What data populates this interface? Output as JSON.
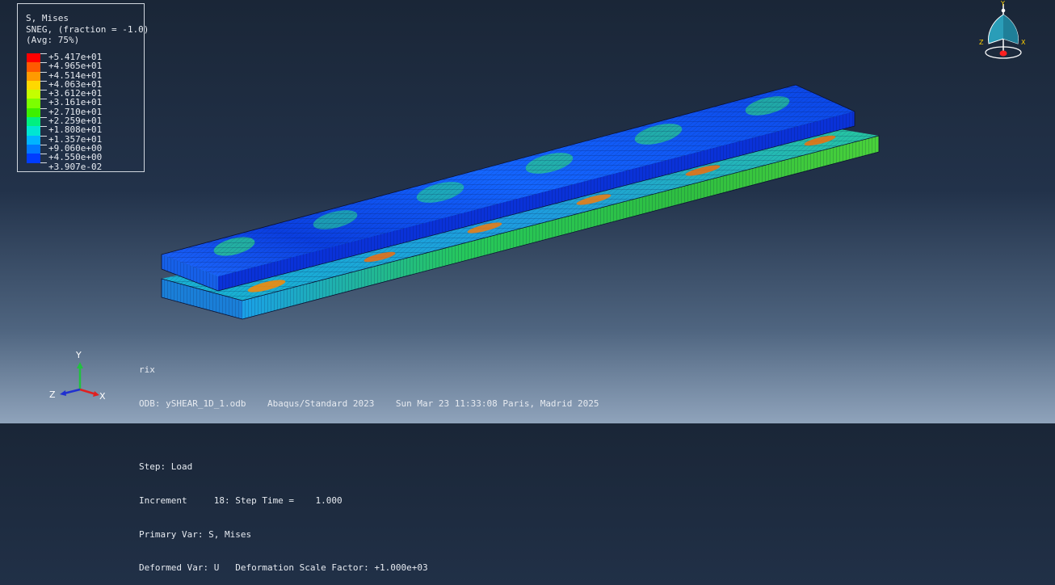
{
  "legend": {
    "title": "S, Mises",
    "subtitle": "SNEG, (fraction = -1.0)",
    "avg": "(Avg: 75%)",
    "colors": [
      "#ff0000",
      "#ff5a00",
      "#ff9a00",
      "#ffd800",
      "#c4ff00",
      "#7cff00",
      "#3cf000",
      "#00f080",
      "#00e6d2",
      "#00b4ff",
      "#0078ff",
      "#003cff"
    ],
    "values": [
      "+5.417e+01",
      "+4.965e+01",
      "+4.514e+01",
      "+4.063e+01",
      "+3.612e+01",
      "+3.161e+01",
      "+2.710e+01",
      "+2.259e+01",
      "+1.808e+01",
      "+1.357e+01",
      "+9.060e+00",
      "+4.550e+00",
      "+3.907e-02"
    ]
  },
  "info": {
    "model": "rix",
    "odb_line": "ODB: ySHEAR_1D_1.odb    Abaqus/Standard 2023    Sun Mar 23 11:33:08 Paris, Madrid 2025",
    "step_line": "Step: Load",
    "increment_line": "Increment     18: Step Time =    1.000",
    "primary_var_line": "Primary Var: S, Mises",
    "deformed_var_line": "Deformed Var: U   Deformation Scale Factor: +1.000e+03"
  },
  "triad": {
    "x_label": "X",
    "y_label": "Y",
    "z_label": "Z"
  },
  "compass": {
    "x_label": "X",
    "y_label": "Y",
    "z_label": "Z"
  }
}
